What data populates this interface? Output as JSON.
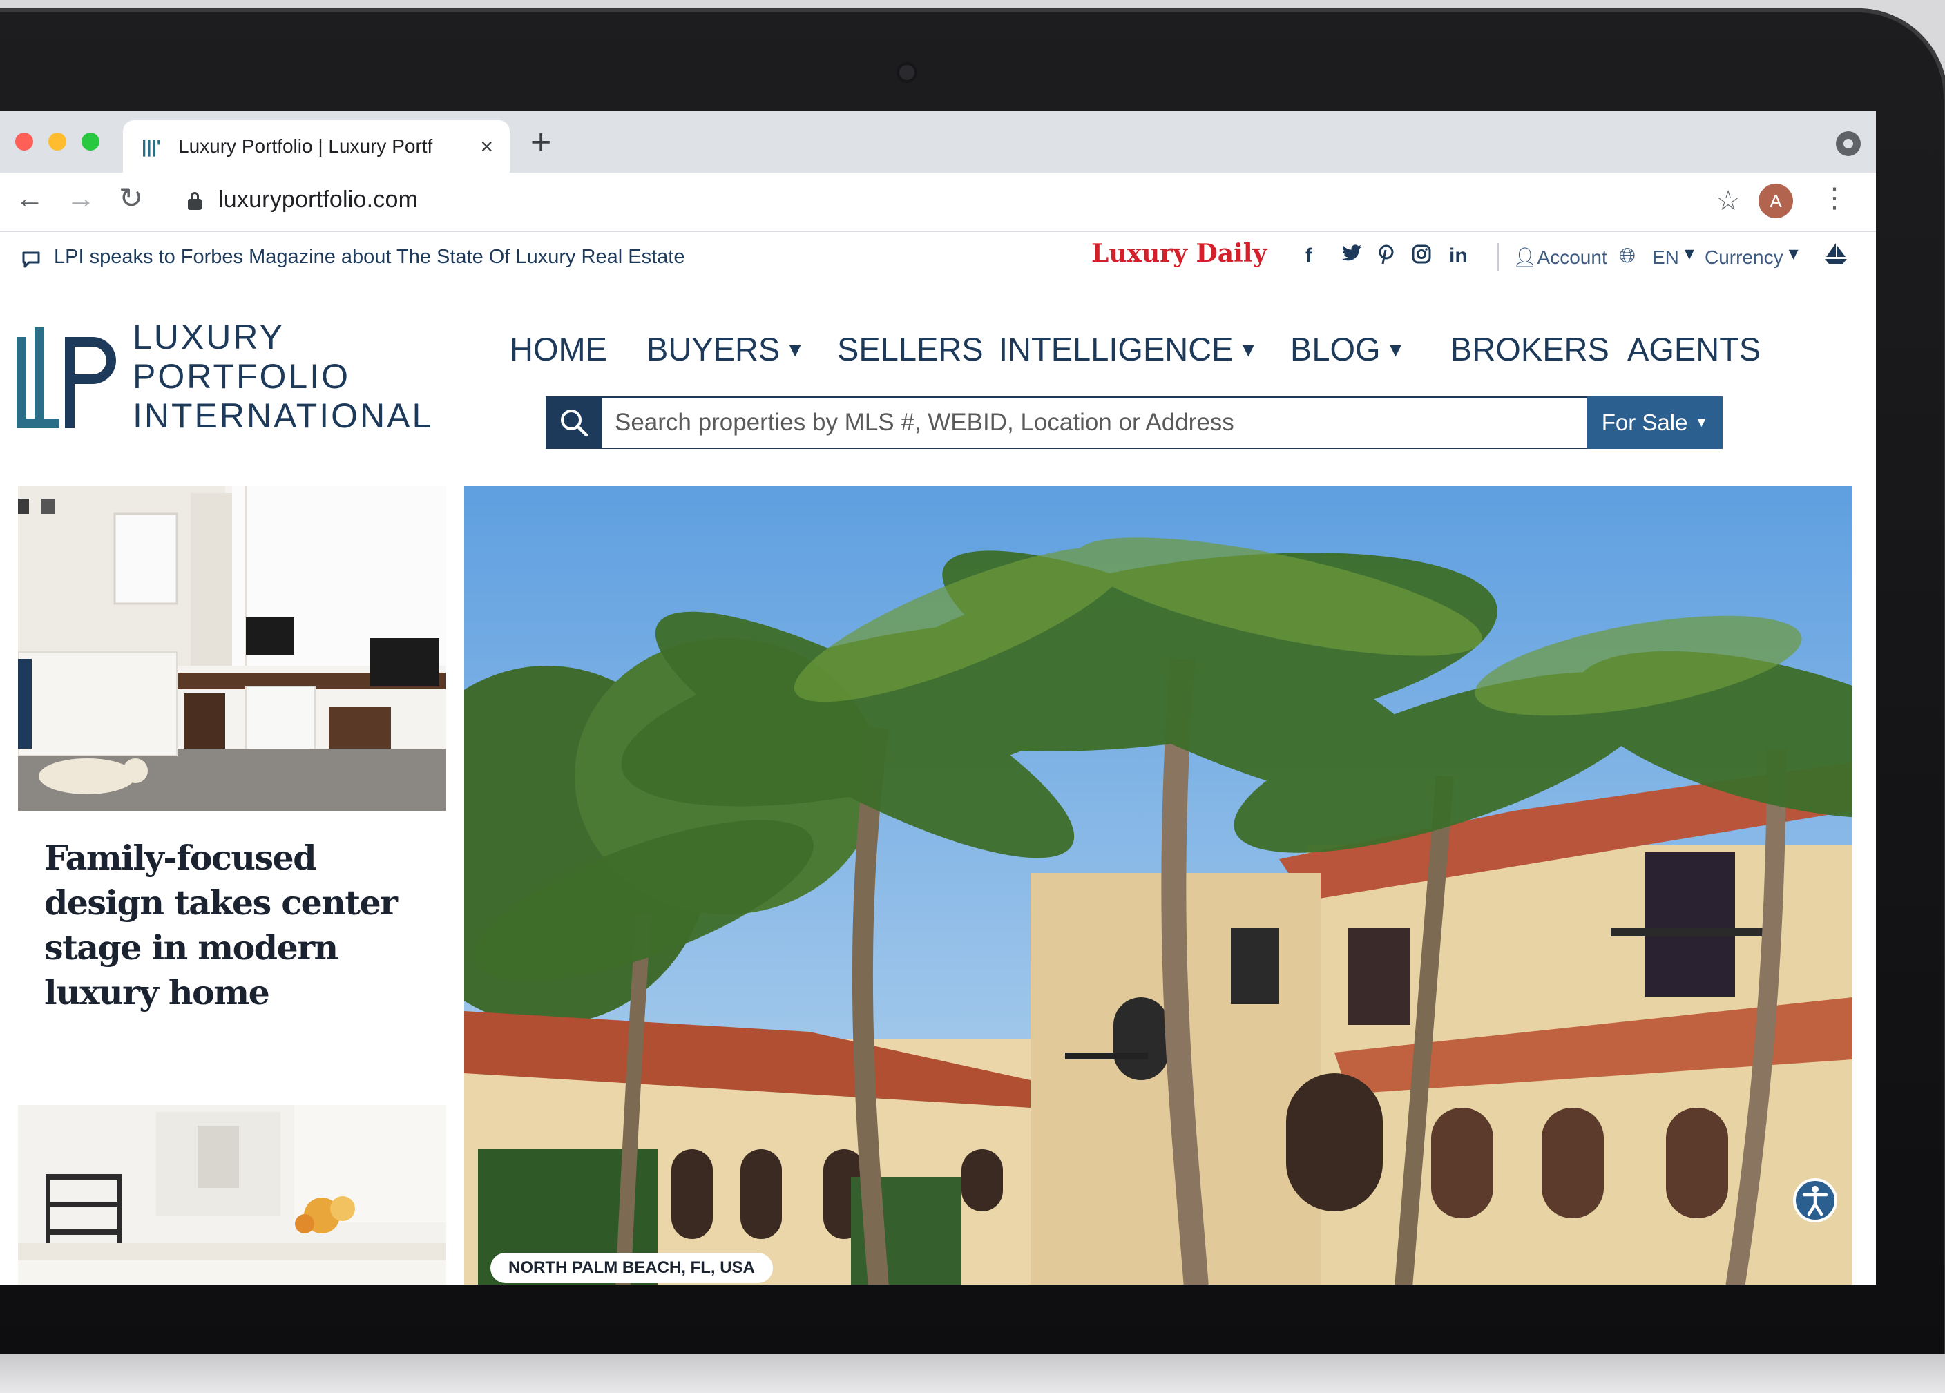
{
  "browser": {
    "tab_title": "Luxury Portfolio | Luxury Portf",
    "tab_close": "×",
    "new_tab": "+",
    "url": "luxuryportfolio.com",
    "avatar_letter": "A"
  },
  "topbar": {
    "news": "LPI speaks to Forbes Magazine about The State Of Luxury Real Estate",
    "luxury_daily": "Luxury Daily",
    "account": "Account",
    "lang": "EN",
    "currency": "Currency"
  },
  "logo": {
    "line1": "LUXURY",
    "line2": "PORTFOLIO",
    "line3": "INTERNATIONAL"
  },
  "nav": {
    "home": "HOME",
    "buyers": "BUYERS",
    "sellers": "SELLERS",
    "intelligence": "INTELLIGENCE",
    "blog": "BLOG",
    "brokers": "BROKERS",
    "agents": "AGENTS"
  },
  "search": {
    "placeholder": "Search properties by MLS #, WEBID, Location or Address",
    "status": "For Sale"
  },
  "feature": {
    "title": "Family-focused design takes center stage in modern luxury home"
  },
  "hero": {
    "location": "NORTH PALM BEACH, FL, USA"
  },
  "colors": {
    "brand_navy": "#1e3a5a",
    "brand_teal": "#2a6f87",
    "luxury_daily_red": "#d3202a",
    "button_blue": "#2a5f8f"
  }
}
